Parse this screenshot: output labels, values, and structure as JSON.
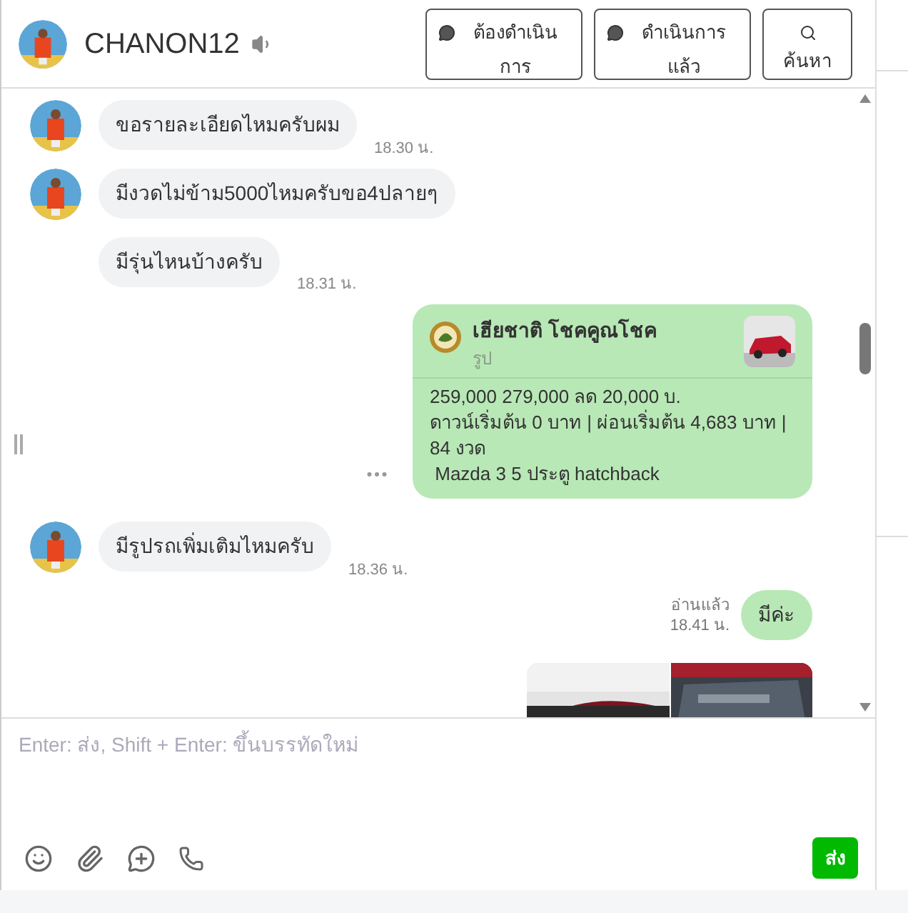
{
  "header": {
    "name": "CHANON12",
    "buttons": [
      {
        "kind": "pending",
        "label": "ต้องดำเนินการ"
      },
      {
        "kind": "done",
        "label": "ดำเนินการแล้ว"
      },
      {
        "kind": "search",
        "label": "ค้นหา"
      }
    ]
  },
  "messages": [
    {
      "kind": "incoming",
      "avatar": true,
      "text": "ขอรายละเอียดไหมครับผม",
      "time": "18.30 น."
    },
    {
      "kind": "incoming",
      "avatar": true,
      "text": "มีงวดไม่ข้าม5000ไหมครับขอ4ปลายๆ"
    },
    {
      "kind": "incoming",
      "avatar": false,
      "text": "มีรุ่นไหนบ้างครับ",
      "time": "18.31 น."
    },
    {
      "kind": "card",
      "title": "เฮียชาติ โชคคูณโชค",
      "subtitle": "รูป",
      "lines": [
        "259,000 279,000 ลด 20,000 บ.",
        "ดาวน์เริ่มต้น 0 บาท | ผ่อนเริ่มต้น 4,683 บาท | 84 งวด",
        " Mazda 3 5 ประตู hatchback"
      ]
    },
    {
      "kind": "incoming",
      "avatar": true,
      "text": "มีรูปรถเพิ่มเติมไหมครับ",
      "time": "18.36 น."
    },
    {
      "kind": "outgoing",
      "text": "มีค่ะ",
      "status": "อ่านแล้ว",
      "time": "18.41 น."
    },
    {
      "kind": "images"
    }
  ],
  "composer": {
    "placeholder": "Enter: ส่ง, Shift + Enter: ขึ้นบรรทัดใหม่",
    "send": "ส่ง"
  }
}
